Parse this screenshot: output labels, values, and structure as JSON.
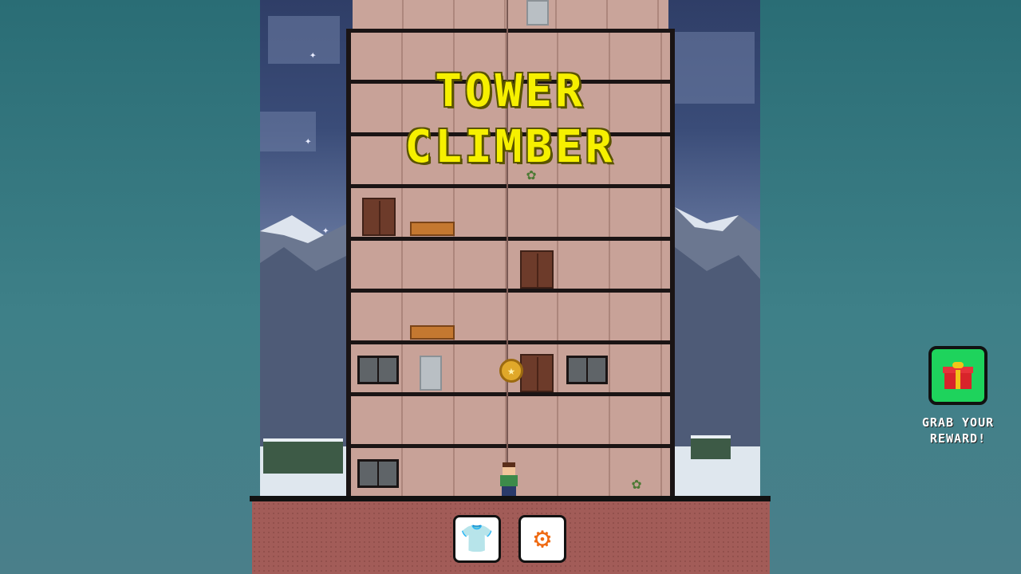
{
  "game": {
    "title_line1": "TOWER",
    "title_line2": "CLIMBER"
  },
  "reward": {
    "label_line1": "GRAB YOUR",
    "label_line2": "REWARD!",
    "icon": "gift-icon"
  },
  "toolbar": {
    "shop_icon": "shirt-icon",
    "settings_icon": "gear-icon"
  },
  "colors": {
    "title": "#f6f000",
    "accent": "#ef6a12",
    "reward_button": "#1ed35c",
    "background": "#2a6d75"
  }
}
